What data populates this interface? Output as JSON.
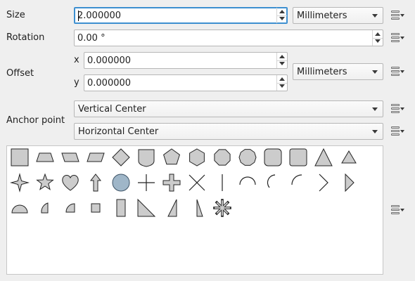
{
  "size": {
    "label": "Size",
    "value": "2.000000",
    "unit": "Millimeters"
  },
  "rotation": {
    "label": "Rotation",
    "value": "0.00 °"
  },
  "offset": {
    "label": "Offset",
    "x_label": "x",
    "x_value": "0.000000",
    "y_label": "y",
    "y_value": "0.000000",
    "unit": "Millimeters"
  },
  "anchor": {
    "label": "Anchor point",
    "vertical": "Vertical Center",
    "horizontal": "Horizontal Center"
  },
  "symbol_shapes": [
    "square",
    "trapezoid",
    "parallelogram-left",
    "parallelogram-right",
    "diamond",
    "shield",
    "pentagon",
    "hexagon",
    "octagon",
    "decagon",
    "rounded-square",
    "rounded-square-large",
    "triangle",
    "triangle-small",
    "four-point-star",
    "star",
    "heart",
    "arrow",
    "circle",
    "cross",
    "cross-fill",
    "x",
    "line",
    "semicircle-arc",
    "third-arc",
    "quarter-arc",
    "arrowhead",
    "filled-arrowhead",
    "half-circle",
    "third-circle",
    "quarter-circle",
    "small-square",
    "rectangle",
    "right-half-triangle",
    "left-half-triangle",
    "right-triangle",
    "asterisk"
  ],
  "colors": {
    "shape_fill": "#cccccc",
    "selected_fill": "#9fb6c8",
    "stroke": "#232323",
    "focus": "#3d8fd0"
  }
}
